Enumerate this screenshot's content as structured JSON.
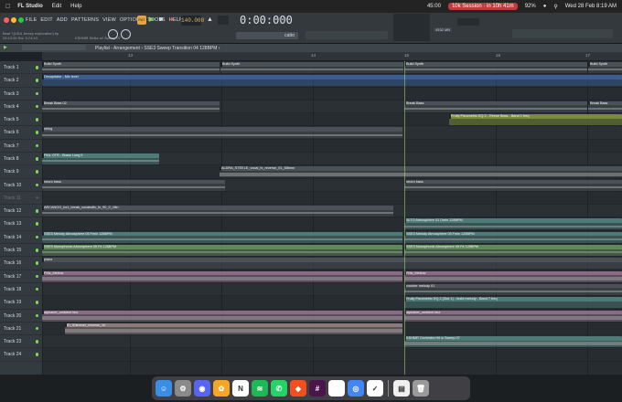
{
  "macbar": {
    "app_name": "FL Studio",
    "menu": [
      "Edit",
      "Help"
    ],
    "timer": "45:00",
    "session": "10k Session · in 10h 41m",
    "battery": "92%",
    "date_time": "Wed 28 Feb  8:19 AM"
  },
  "fl": {
    "menu": [
      "FILE",
      "EDIT",
      "ADD",
      "PATTERNS",
      "VIEW",
      "OPTIONS",
      "TOOLS",
      "HELP"
    ],
    "mode": "PAT",
    "bpm": "140.000",
    "time": "0:00:000",
    "time_unit": "M:S:CS",
    "project_line1": "Beat 7(USA Jersey exploration).flp",
    "project_line2": "24:12:00 Sw: 3:74:19",
    "project_line3": "KSHMR Strike w/ Sweep 07",
    "pattern_name": "catto",
    "cpu": "4532 MB",
    "playlist_title": "Playlist - Arrangement › SSE3 Sweep Transition 04 128BPM ›",
    "ruler": [
      "13",
      "14",
      "15",
      "16",
      "17"
    ]
  },
  "tracks": [
    {
      "name": "Track 1",
      "muted": false
    },
    {
      "name": "Track 2",
      "muted": false
    },
    {
      "name": "Track 3",
      "muted": false
    },
    {
      "name": "Track 4",
      "muted": false
    },
    {
      "name": "Track 5",
      "muted": false
    },
    {
      "name": "Track 6",
      "muted": false
    },
    {
      "name": "Track 7",
      "muted": false
    },
    {
      "name": "Track 8",
      "muted": false
    },
    {
      "name": "Track 9",
      "muted": false
    },
    {
      "name": "Track 10",
      "muted": false
    },
    {
      "name": "Track 11",
      "muted": true
    },
    {
      "name": "Track 12",
      "muted": false
    },
    {
      "name": "Track 13",
      "muted": false
    },
    {
      "name": "Track 14",
      "muted": false
    },
    {
      "name": "Track 15",
      "muted": false
    },
    {
      "name": "Track 16",
      "muted": false
    },
    {
      "name": "Track 17",
      "muted": false
    },
    {
      "name": "Track 18",
      "muted": false
    },
    {
      "name": "Track 19",
      "muted": false
    },
    {
      "name": "Track 20",
      "muted": false
    },
    {
      "name": "Track 21",
      "muted": false
    },
    {
      "name": "Track 23",
      "muted": false
    },
    {
      "name": "Track 24",
      "muted": false
    }
  ],
  "clips": [
    {
      "row": 0,
      "label": "Build Synth",
      "color": "#4a5257",
      "wave": "line"
    },
    {
      "row": 0,
      "label": "Build Synth",
      "color": "#4a5257",
      "wave": "line"
    },
    {
      "row": 0,
      "label": "Build Synth",
      "color": "#4a5257",
      "wave": "line"
    },
    {
      "row": 0,
      "label": "Build Synth",
      "color": "#4a5257",
      "wave": "line"
    },
    {
      "row": 1,
      "label": "Decapitator - Mix level",
      "color": "#3a5d8f",
      "wave": "none"
    },
    {
      "row": 3,
      "label": "Break Bass 02",
      "color": "#4a5257",
      "wave": "line"
    },
    {
      "row": 3,
      "label": "Break Bass",
      "color": "#4a5257",
      "wave": "line"
    },
    {
      "row": 3,
      "label": "Break Bass",
      "color": "#4a5257",
      "wave": "line"
    },
    {
      "row": 4,
      "label": "Fruity Parametric EQ 2 - Reese Bass - Band 1 freq",
      "color": "#7a8c3c",
      "wave": "none"
    },
    {
      "row": 5,
      "label": "string",
      "color": "#4a5257",
      "wave": "line"
    },
    {
      "row": 7,
      "label": "PML OTR - Brass Long 5",
      "color": "#4e7a78",
      "wave": "line"
    },
    {
      "row": 8,
      "label": "ALDRA_STEELE_vocal_fx_reverse_01_68bmn",
      "color": "#4a5257",
      "wave": "thick"
    },
    {
      "row": 9,
      "label": "neuro bass",
      "color": "#4a5257",
      "wave": "line"
    },
    {
      "row": 9,
      "label": "neuro bass",
      "color": "#4a5257",
      "wave": "line"
    },
    {
      "row": 11,
      "label": "ARCANOG_bx1_break_vocalsdfx_fx_90_C_Min",
      "color": "#4a5257",
      "wave": "line"
    },
    {
      "row": 12,
      "label": "SLTO Atmosphere 01 Dmin 128BPM",
      "color": "#4e7a78",
      "wave": "line"
    },
    {
      "row": 13,
      "label": "SSE3 Melody Atmosphere 05 Fmin 128BPM",
      "color": "#4e7a78",
      "wave": "line"
    },
    {
      "row": 13,
      "label": "SSE3 Melody Atmosphere 05 Fmin 128BPM",
      "color": "#4e7a78",
      "wave": "line"
    },
    {
      "row": 14,
      "label": "SSE3 Monophonic Atmosphere 05 F# 128BPM",
      "color": "#5e8a5a",
      "wave": "line"
    },
    {
      "row": 14,
      "label": "SSE3 Monophonic Atmosphere 05 F# 128BPM",
      "color": "#5e8a5a",
      "wave": "line"
    },
    {
      "row": 15,
      "label": "piano",
      "color": "#4a5257",
      "wave": "none"
    },
    {
      "row": 16,
      "label": "FMs_Mellow",
      "color": "#8a6a84",
      "wave": "thick"
    },
    {
      "row": 16,
      "label": "FMs_Mellow",
      "color": "#8a6a84",
      "wave": "thick"
    },
    {
      "row": 17,
      "label": "counter melody 01",
      "color": "#4a5257",
      "wave": "line"
    },
    {
      "row": 18,
      "label": "Fruity Parametric EQ 2 (Slot 1) - build melody - Band 7 freq",
      "color": "#4e7a78",
      "wave": "none"
    },
    {
      "row": 19,
      "label": "alphabet_ambient blur",
      "color": "#8a6a84",
      "wave": "thick"
    },
    {
      "row": 19,
      "label": "alphabet_ambient blur",
      "color": "#8a6a84",
      "wave": "thick"
    },
    {
      "row": 20,
      "label": "ID_Shimmer_reverse_10",
      "color": "#8a7a7a",
      "wave": "thick"
    },
    {
      "row": 21,
      "label": "KSHMR Orchestra Hit w Sweep 07",
      "color": "#4e7a78",
      "wave": "thick"
    }
  ],
  "dock": [
    "Finder",
    "Settings",
    "Discord",
    "FL Studio",
    "Notion",
    "Spotify",
    "WhatsApp",
    "Figma",
    "Slack",
    "Calendar",
    "Chrome",
    "Tasks",
    "Notes",
    "Trash"
  ]
}
